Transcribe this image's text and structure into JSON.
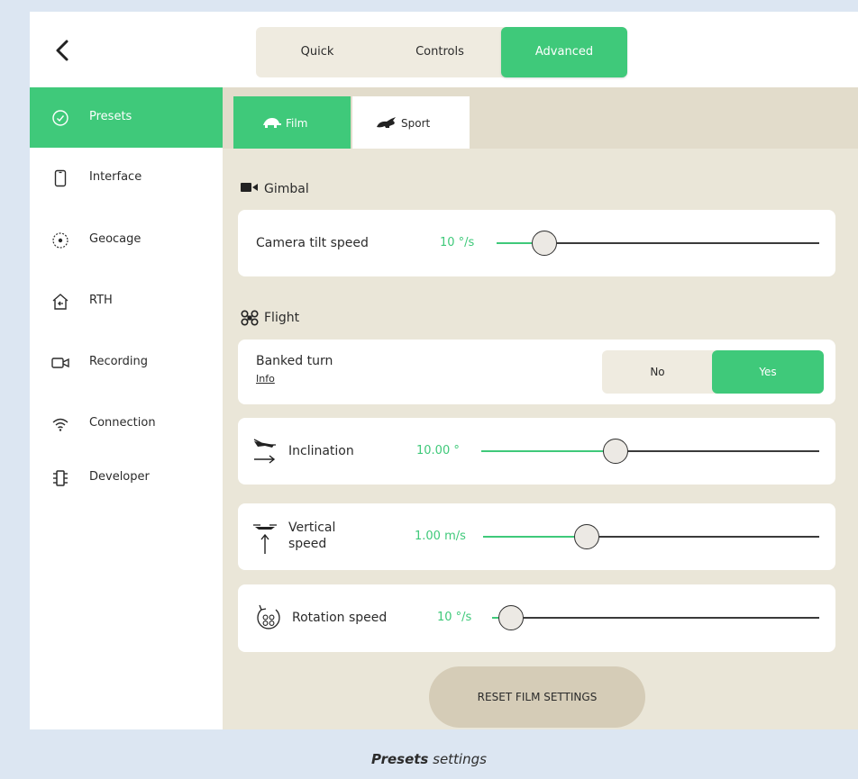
{
  "header": {
    "back_icon": "chevron-left-icon",
    "tabs": [
      {
        "label": "Quick",
        "active": false
      },
      {
        "label": "Controls",
        "active": false
      },
      {
        "label": "Advanced",
        "active": true
      }
    ]
  },
  "sidebar": {
    "items": [
      {
        "label": "Presets",
        "icon": "check-circle-icon",
        "active": true
      },
      {
        "label": "Interface",
        "icon": "phone-icon",
        "active": false
      },
      {
        "label": "Geocage",
        "icon": "geocage-icon",
        "active": false
      },
      {
        "label": "RTH",
        "icon": "home-return-icon",
        "active": false
      },
      {
        "label": "Recording",
        "icon": "video-camera-icon",
        "active": false
      },
      {
        "label": "Connection",
        "icon": "wifi-icon",
        "active": false
      },
      {
        "label": "Developer",
        "icon": "chip-icon",
        "active": false
      }
    ]
  },
  "subtabs": [
    {
      "label": "Film",
      "icon": "turtle-icon",
      "active": true
    },
    {
      "label": "Sport",
      "icon": "rabbit-icon",
      "active": false
    }
  ],
  "gimbal": {
    "title": "Gimbal",
    "icon": "camera-icon",
    "camera_tilt": {
      "label": "Camera tilt speed",
      "value": "10 °/s",
      "level": 0.11
    }
  },
  "flight": {
    "title": "Flight",
    "icon": "drone-icon",
    "banked_turn": {
      "label": "Banked turn",
      "info": "Info",
      "options": [
        "No",
        "Yes"
      ],
      "selected": "Yes"
    },
    "inclination": {
      "label": "Inclination",
      "value": "10.00 °",
      "icon": "drone-tilt-icon",
      "level": 0.36
    },
    "vertical_speed": {
      "label_line1": "Vertical",
      "label_line2": "speed",
      "value": "1.00 m/s",
      "icon": "drone-up-icon",
      "level": 0.27
    },
    "rotation_speed": {
      "label": "Rotation speed",
      "value": "10 °/s",
      "icon": "rotation-icon",
      "level": 0.02
    }
  },
  "reset_button": "RESET FILM SETTINGS",
  "caption": {
    "bold": "Presets",
    "rest": " settings"
  },
  "colors": {
    "accent": "#3fc97a",
    "content_bg": "#eae6d8",
    "page_bg": "#dce6f2"
  }
}
